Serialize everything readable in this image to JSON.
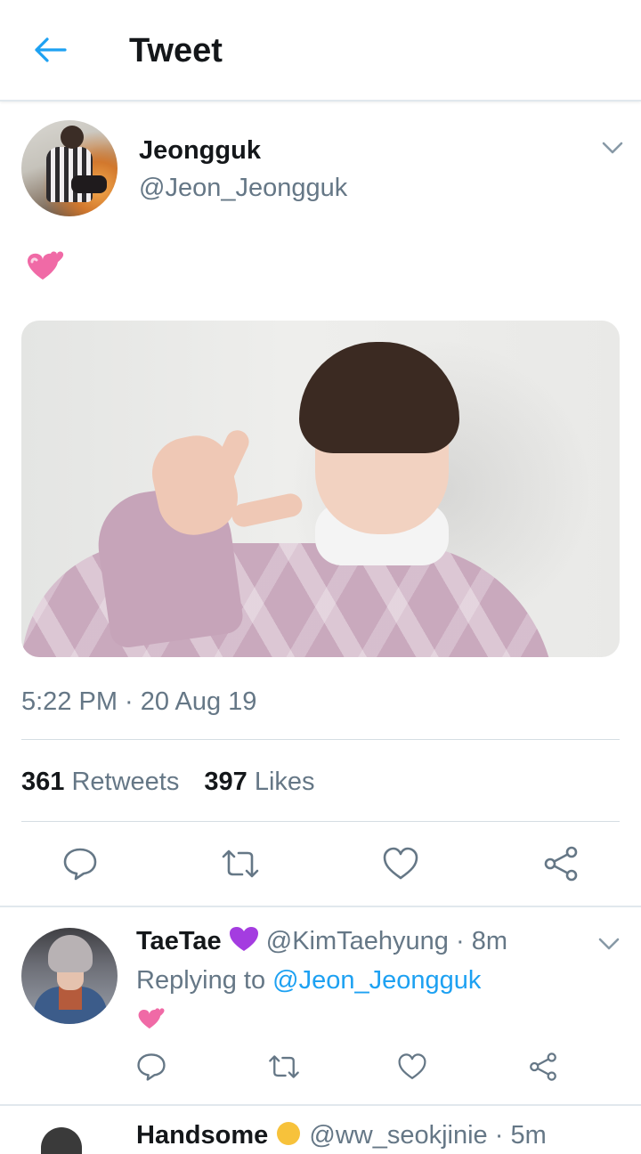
{
  "header": {
    "title": "Tweet",
    "back_icon": "arrow-left-icon",
    "accent_color": "#1da1f2"
  },
  "tweet": {
    "author_name": "Jeongguk",
    "author_handle": "@Jeon_Jeongguk",
    "text_emoji": "revolving-hearts-emoji",
    "timestamp": "5:22 PM · 20 Aug 19",
    "retweets_count": "361",
    "retweets_label": "Retweets",
    "likes_count": "397",
    "likes_label": "Likes",
    "actions": [
      "reply-icon",
      "retweet-icon",
      "like-icon",
      "share-icon"
    ]
  },
  "reply": {
    "author_name": "TaeTae",
    "name_emoji": "purple-heart-emoji",
    "author_handle": "@KimTaehyung",
    "time": "· 8m",
    "replying_prefix": "Replying to",
    "replying_to": "@Jeon_Jeongguk",
    "text_emoji": "revolving-hearts-emoji",
    "actions": [
      "reply-icon",
      "retweet-icon",
      "like-icon",
      "share-icon"
    ]
  },
  "next_reply_partial": {
    "author_name": "Handsome",
    "name_emoji": "face-emoji",
    "author_handle": "@ww_seokjinie",
    "time": "· 5m"
  },
  "colors": {
    "secondary_text": "#657786",
    "primary_text": "#14171a",
    "divider": "#e1e8ed",
    "heart_pink": "#f06aa6"
  }
}
